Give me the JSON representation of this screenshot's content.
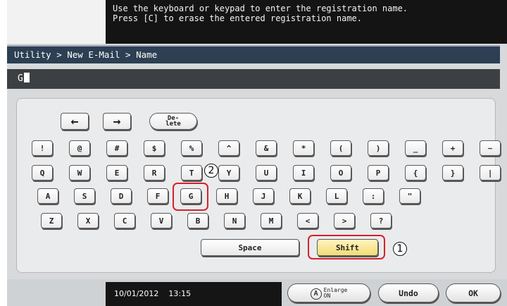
{
  "instructions": {
    "line1": "Use the keyboard or keypad to enter the registration name.",
    "line2": "Press [C] to erase the entered registration name."
  },
  "breadcrumb": "Utility > New E-Mail > Name",
  "entry": {
    "value": "G"
  },
  "keys": {
    "left_arrow": "←",
    "right_arrow": "→",
    "delete_line1": "De-",
    "delete_line2": "lete",
    "row1": [
      "!",
      "@",
      "#",
      "$",
      "%",
      "^",
      "&",
      "*",
      "(",
      ")",
      "_",
      "+",
      "~"
    ],
    "row2": [
      "Q",
      "W",
      "E",
      "R",
      "T",
      "Y",
      "U",
      "I",
      "O",
      "P",
      "{",
      "}",
      "|"
    ],
    "row3": [
      "A",
      "S",
      "D",
      "F",
      "G",
      "H",
      "J",
      "K",
      "L",
      ":",
      "\""
    ],
    "row4": [
      "Z",
      "X",
      "C",
      "V",
      "B",
      "N",
      "M",
      "<",
      ">",
      "?"
    ],
    "space": "Space",
    "shift": "Shift"
  },
  "callouts": {
    "shift": "1",
    "g_key": "2"
  },
  "status": {
    "date": "10/01/2012",
    "time": "13:15"
  },
  "buttons": {
    "enlarge_icon": "A",
    "enlarge_line1": "Enlarge",
    "enlarge_line2": "ON",
    "undo": "Undo",
    "ok": "OK"
  },
  "colors": {
    "highlight": "#d8202b",
    "shift_fill": "#f2dc72",
    "title_bar": "#2d3f53"
  },
  "icons": {
    "enlarge": "magnify-A-icon",
    "left": "left-arrow-icon",
    "right": "right-arrow-icon"
  }
}
